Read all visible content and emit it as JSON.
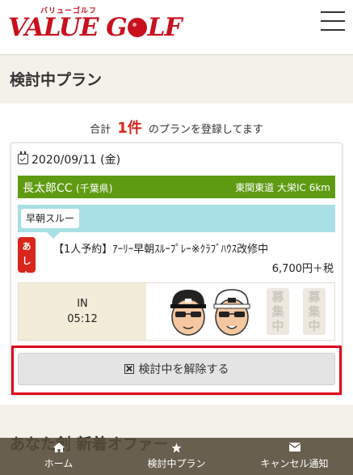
{
  "header": {
    "logo_sub": "バリューゴルフ",
    "logo_text_1": "VALUE G",
    "logo_text_2": "LF"
  },
  "page": {
    "title": "検討中プラン"
  },
  "summary": {
    "prefix": "合計",
    "count": "1件",
    "suffix": "のプランを登録してます"
  },
  "plan": {
    "date": "2020/09/11 (金)",
    "course_name": "長太郎CC",
    "course_pref": "(千葉県)",
    "course_access": "東関東道 大栄IC 6km",
    "plan_tag": "早朝スルー",
    "tomorrow_badge": "あした",
    "plan_title": "【1人予約】ｱｰﾘｰ早朝ｽﾙｰﾌﾟﾚｰ※ｸﾗﾌﾞﾊｳｽ改修中",
    "price": "6,700円＋税",
    "tee_course": "IN",
    "tee_time": "05:12",
    "recruit_1": "募集中",
    "recruit_2": "募集中",
    "release_label": "検討中を解除する"
  },
  "section_peek": "あなた創 新着オファー",
  "tabs": [
    {
      "label": "ホーム",
      "icon": "home-icon"
    },
    {
      "label": "検討中プラン",
      "icon": "star-icon"
    },
    {
      "label": "キャンセル通知",
      "icon": "mail-icon"
    }
  ],
  "colors": {
    "brand": "#c8101e",
    "course_bar": "#5e9b12",
    "plan_bar": "#a8e0e6",
    "highlight_border": "#e0001b",
    "tabbar": "#554a38"
  }
}
